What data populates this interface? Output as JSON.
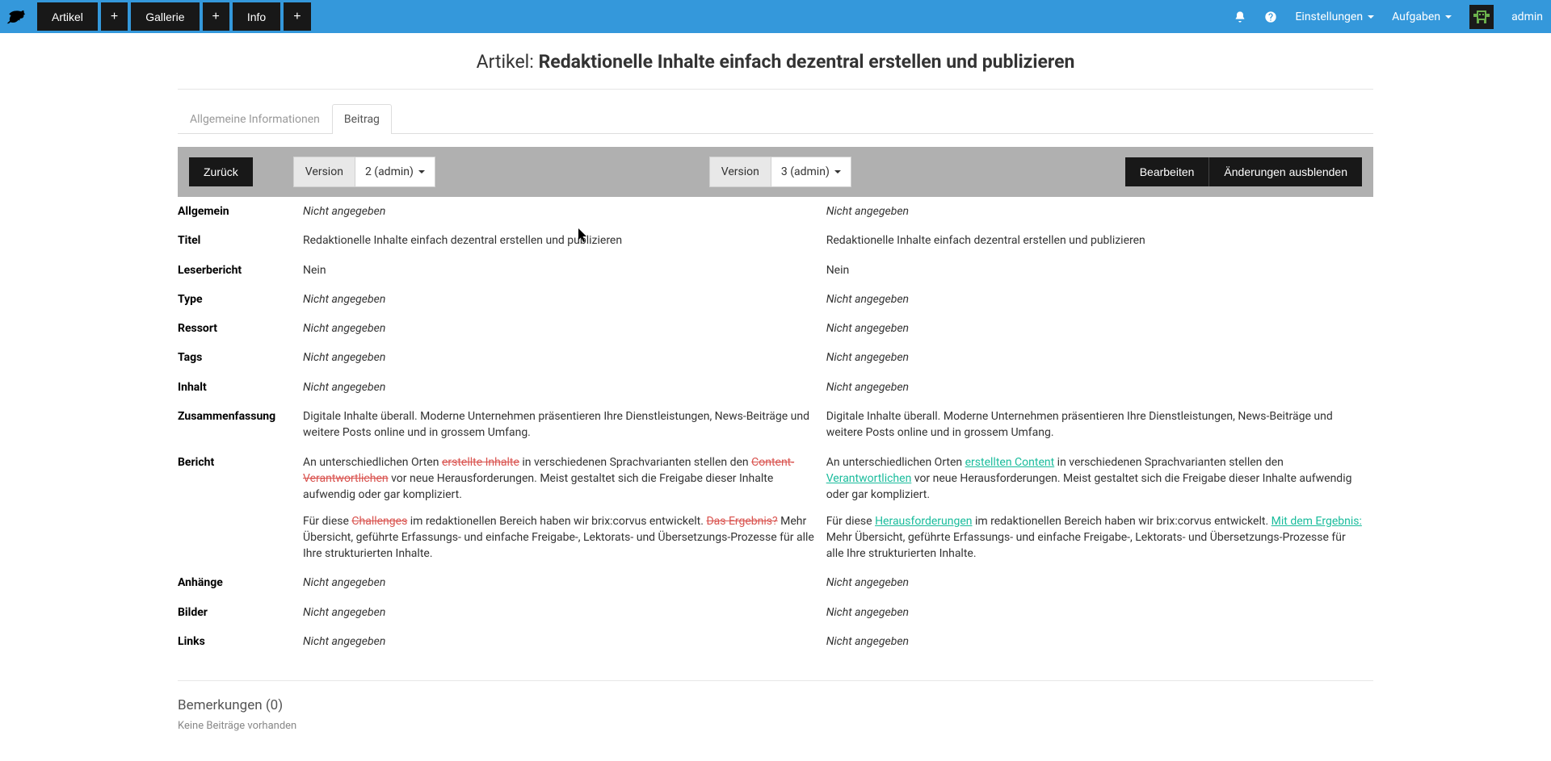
{
  "topbar": {
    "nav": [
      {
        "label": "Artikel"
      },
      {
        "label": "Gallerie"
      },
      {
        "label": "Info"
      }
    ],
    "plus": "+",
    "settings": "Einstellungen",
    "tasks": "Aufgaben",
    "user": "admin"
  },
  "page": {
    "prefix": "Artikel: ",
    "title": "Redaktionelle Inhalte einfach dezentral erstellen und publizieren"
  },
  "tabs": {
    "general": "Allgemeine Informationen",
    "beitrag": "Beitrag"
  },
  "toolbar": {
    "back": "Zurück",
    "version_label": "Version",
    "version_a": "2 (admin)",
    "version_b": "3 (admin)",
    "edit": "Bearbeiten",
    "hide_changes": "Änderungen ausblenden"
  },
  "na": "Nicht angegeben",
  "rows": {
    "allgemein": "Allgemein",
    "titel": "Titel",
    "titel_a": "Redaktionelle Inhalte einfach dezentral erstellen und publizieren",
    "titel_b": "Redaktionelle Inhalte einfach dezentral erstellen und publizieren",
    "leserbericht": "Leserbericht",
    "leser_a": "Nein",
    "leser_b": "Nein",
    "type": "Type",
    "ressort": "Ressort",
    "tags": "Tags",
    "inhalt": "Inhalt",
    "zusammenfassung": "Zusammenfassung",
    "zf_a": "Digitale Inhalte überall. Moderne Unternehmen präsentieren Ihre Dienstleistungen, News-Beiträge und weitere Posts online und in grossem Umfang.",
    "zf_b": "Digitale Inhalte überall. Moderne Unternehmen präsentieren Ihre Dienstleistungen, News-Beiträge und weitere Posts online und in grossem Umfang.",
    "bericht": "Bericht",
    "bericht_a": {
      "p1_1": "An unterschiedlichen Orten ",
      "p1_del1": "erstellte Inhalte",
      "p1_2": " in verschiedenen Sprachvarianten stellen den ",
      "p1_del2": "Content-Verantwortlichen",
      "p1_3": " vor neue Herausforderungen. Meist gestaltet sich die Freigabe dieser Inhalte aufwendig oder gar kompliziert.",
      "p2_1": "Für diese ",
      "p2_del1": "Challenges",
      "p2_2": " im redaktionellen Bereich haben wir brix:corvus entwickelt. ",
      "p2_del2": "Das Ergebnis?",
      "p2_3": " Mehr Übersicht, geführte Erfassungs- und einfache Freigabe-, Lektorats- und Übersetzungs-Prozesse für alle Ihre strukturierten Inhalte."
    },
    "bericht_b": {
      "p1_1": "An unterschiedlichen Orten ",
      "p1_ins1": "erstellten Content",
      "p1_2": " in verschiedenen Sprachvarianten stellen den ",
      "p1_ins2": "Verantwortlichen",
      "p1_3": " vor neue Herausforderungen. Meist gestaltet sich die Freigabe dieser Inhalte aufwendig oder gar kompliziert.",
      "p2_1": "Für diese ",
      "p2_ins1": "Herausforderungen",
      "p2_2": " im redaktionellen Bereich haben wir brix:corvus entwickelt. ",
      "p2_ins2": "Mit dem Ergebnis:",
      "p2_3": " Mehr Übersicht, geführte Erfassungs- und einfache Freigabe-, Lektorats- und Übersetzungs-Prozesse für alle Ihre strukturierten Inhalte."
    },
    "anhaenge": "Anhänge",
    "bilder": "Bilder",
    "links": "Links"
  },
  "remarks": {
    "title": "Bemerkungen (0)",
    "none": "Keine Beiträge vorhanden"
  }
}
